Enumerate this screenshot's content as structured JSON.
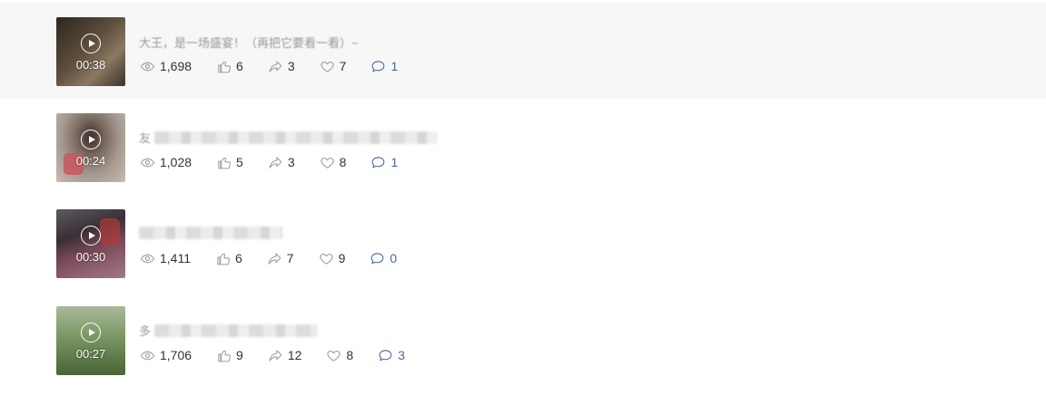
{
  "videos": [
    {
      "duration": "00:38",
      "title_lead": "大王，是一场盛宴！（再把它要看一看）~",
      "views": "1,698",
      "likes": "6",
      "shares": "3",
      "favorites": "7",
      "comments": "1",
      "thumb_colors": [
        "#3b3328",
        "#6b5a44",
        "#2a2620"
      ]
    },
    {
      "duration": "00:24",
      "title_lead": "友",
      "views": "1,028",
      "likes": "5",
      "shares": "3",
      "favorites": "8",
      "comments": "1",
      "thumb_colors": [
        "#8a7a6e",
        "#a99a8e",
        "#5f5650"
      ]
    },
    {
      "duration": "00:30",
      "title_lead": "",
      "views": "1,411",
      "likes": "6",
      "shares": "7",
      "favorites": "9",
      "comments": "0",
      "thumb_colors": [
        "#3a2d34",
        "#7a4a5a",
        "#9b6a74"
      ]
    },
    {
      "duration": "00:27",
      "title_lead": "多",
      "views": "1,706",
      "likes": "9",
      "shares": "12",
      "favorites": "8",
      "comments": "3",
      "thumb_colors": [
        "#6e8a5a",
        "#9aae88",
        "#4a6438"
      ]
    }
  ],
  "colors": {
    "hover_row_bg": "#f7f7f7",
    "icon_gray": "#9aa0a6",
    "comment_blue": "#4a6a9a"
  },
  "icons": {
    "views": "eye-icon",
    "likes": "thumbs-up-icon",
    "shares": "share-icon",
    "favorites": "heart-icon",
    "comments": "comment-icon",
    "play": "play-icon"
  }
}
